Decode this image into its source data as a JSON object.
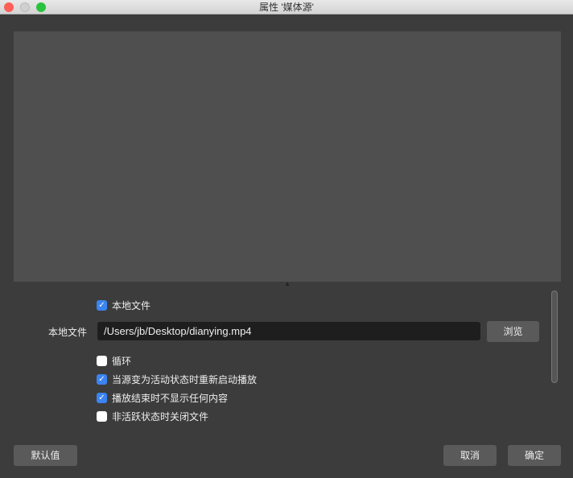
{
  "window": {
    "title": "属性 '媒体源'"
  },
  "checkboxes": [
    {
      "label": "本地文件",
      "checked": true
    },
    {
      "label": "循环",
      "checked": false
    },
    {
      "label": "当源变为活动状态时重新启动播放",
      "checked": true
    },
    {
      "label": "播放结束时不显示任何内容",
      "checked": true
    },
    {
      "label": "非活跃状态时关闭文件",
      "checked": false
    }
  ],
  "file": {
    "label": "本地文件",
    "value": "/Users/jb/Desktop/dianying.mp4",
    "browse": "浏览"
  },
  "buttons": {
    "defaults": "默认值",
    "cancel": "取消",
    "ok": "确定"
  },
  "icons": {
    "check": "✓"
  }
}
